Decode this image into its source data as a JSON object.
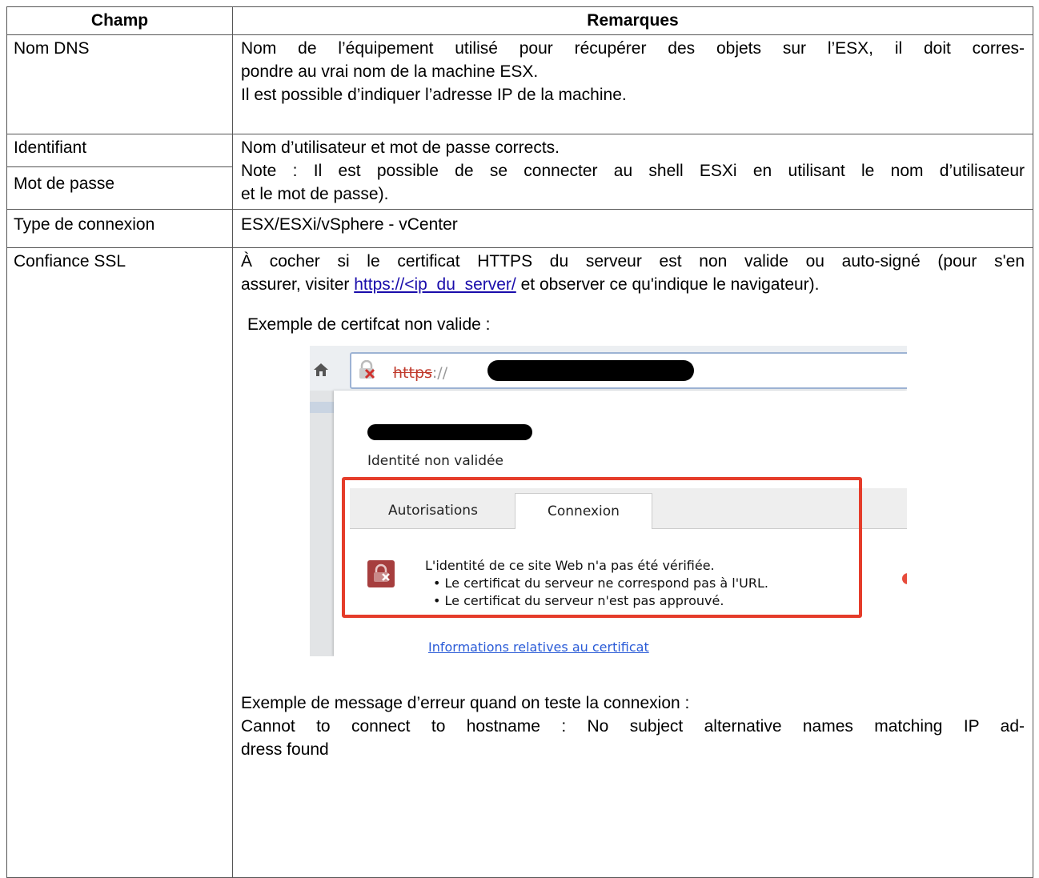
{
  "table": {
    "headers": {
      "champ": "Champ",
      "remarques": "Remarques"
    },
    "rows": {
      "dns": {
        "champ": "Nom DNS",
        "lines": [
          "Nom de l’équipement utilisé pour récupérer des objets sur l’ESX, il doit corres-",
          "pondre au vrai nom de la machine ESX.",
          "Il est possible d’indiquer l’adresse IP de la machine."
        ]
      },
      "identifiant": {
        "champ": "Identifiant"
      },
      "mot_de_passe": {
        "champ": "Mot de passe"
      },
      "credentials_remarks": [
        "Nom d’utilisateur et mot de passe corrects.",
        "Note : Il est possible de se connecter au shell ESXi en utilisant le nom d’utilisateur",
        "et le mot de passe)."
      ],
      "type": {
        "champ": "Type de connexion",
        "remark": "ESX/ESXi/vSphere - vCenter"
      },
      "ssl": {
        "champ": "Confiance SSL",
        "line1": "À cocher si le certificat HTTPS du serveur est non valide ou auto-signé (pour s'en",
        "line2_before": "assurer, visiter ",
        "line2_link": "https://<ip_du_server/",
        "line2_after": " et observer ce qu'indique le navigateur).",
        "example_title": "Exemple de certifcat non valide :",
        "error_title": "Exemple de message d’erreur quand on teste la connexion :",
        "error_line1": "Cannot to connect to hostname : No subject alternative names matching IP ad-",
        "error_line2": "dress found"
      }
    }
  },
  "screenshot": {
    "url_scheme": "https",
    "url_sep": "://",
    "identity": "Identité non validée",
    "tabs": [
      "Autorisations",
      "Connexion"
    ],
    "warning_title": "L'identité de ce site Web n'a pas été vérifiée.",
    "bullets": [
      "• Le certificat du serveur ne correspond pas à l'URL.",
      "• Le certificat du serveur n'est pas approuvé."
    ],
    "cert_link": "Informations relatives au certificat",
    "icons": [
      "home-icon",
      "broken-lock-icon",
      "warning-lock-icon"
    ],
    "colors": {
      "highlight": "#e53c2a",
      "link": "#1a0dab",
      "warning": "#a63e3e"
    }
  }
}
